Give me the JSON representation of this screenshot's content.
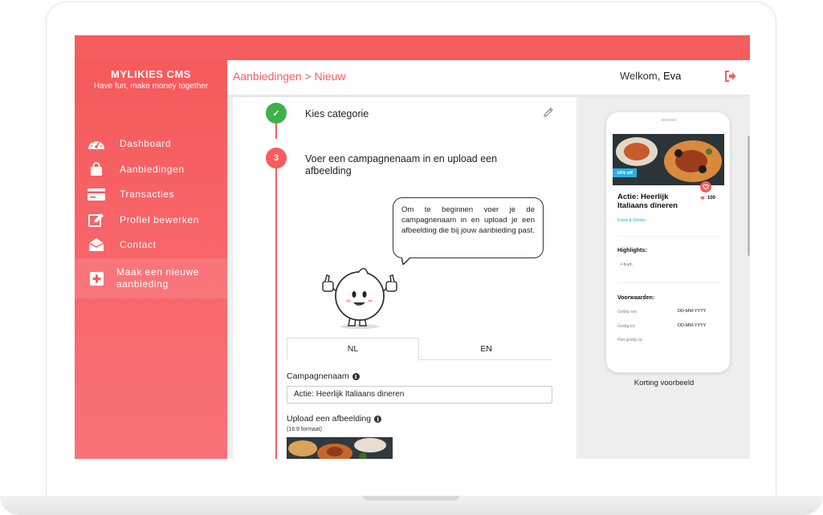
{
  "app": {
    "brand": "MYLIKIES CMS",
    "tagline": "Have fun, make money together",
    "accent_color": "#f55d5e"
  },
  "sidebar": {
    "items": [
      {
        "label": "Dashboard",
        "icon": "dashboard-icon"
      },
      {
        "label": "Aanbiedingen",
        "icon": "shopping-bag-icon"
      },
      {
        "label": "Transacties",
        "icon": "credit-card-icon"
      },
      {
        "label": "Profiel bewerken",
        "icon": "edit-icon"
      },
      {
        "label": "Contact",
        "icon": "envelope-icon"
      }
    ],
    "cta": {
      "label": "Maak een nieuwe aanbieding",
      "icon": "plus-icon"
    }
  },
  "header": {
    "breadcrumb": "Aanbiedingen > Nieuw",
    "welcome_prefix": "Welkom,",
    "user_name": "Eva",
    "logout_icon": "logout-icon"
  },
  "steps": [
    {
      "status": "done",
      "title": "Kies categorie",
      "badge": "✓"
    },
    {
      "status": "active",
      "number": "3",
      "title": "Voer een campagnenaam in en upload een afbeelding"
    }
  ],
  "helper_bubble": "Om te beginnen voer je de campagnenaam in en upload je een afbeelding die bij jouw aanbieding past.",
  "form": {
    "tabs": [
      {
        "label": "NL",
        "active": true
      },
      {
        "label": "EN",
        "active": false
      }
    ],
    "campaign_label": "Campagnenaam",
    "campaign_value": "Actie: Heerlijk Italiaans dineren",
    "upload_label": "Upload een afbeelding",
    "upload_hint": "(16:9 formaat)"
  },
  "preview": {
    "discount_badge": "10% off",
    "title": "Actie: Heerlijk Italiaans dineren",
    "likes": "100",
    "category": "Food & Drinks",
    "highlights_heading": "Highlights:",
    "highlights": [
      "n.v.t."
    ],
    "conditions_heading": "Voorwaarden:",
    "conditions": [
      {
        "label": "Geldig van:",
        "value": "DD-MM-YYYY"
      },
      {
        "label": "Geldig tot:",
        "value": "DD-MM-YYYY"
      },
      {
        "label": "Niet geldig op:",
        "value": ""
      }
    ],
    "caption": "Korting voorbeeld"
  }
}
